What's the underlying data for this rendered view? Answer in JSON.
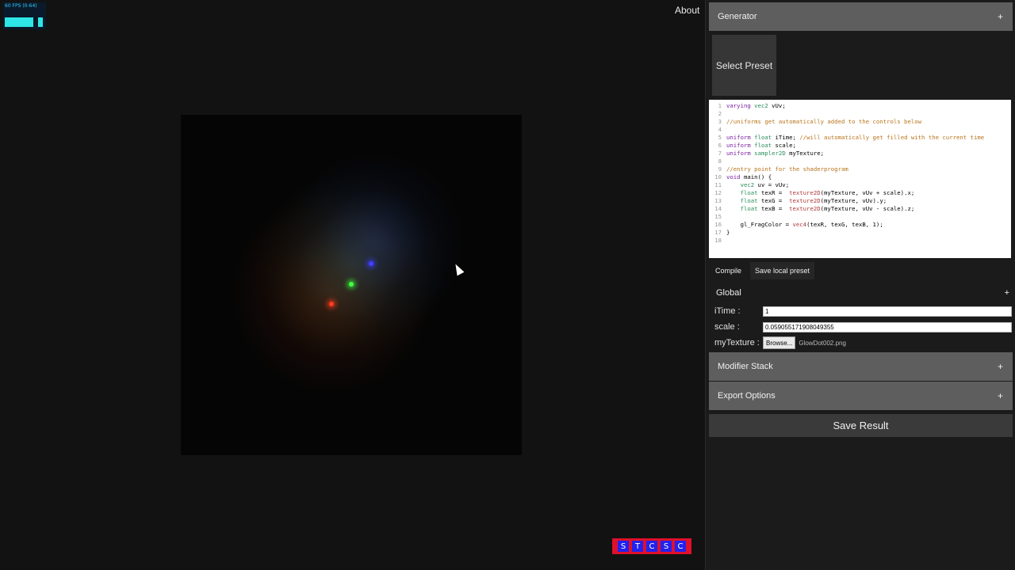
{
  "fps": {
    "label": "60 FPS (0-64)"
  },
  "header": {
    "about": "About"
  },
  "preview": {
    "description_dots": [
      "red",
      "green",
      "blue"
    ]
  },
  "stcsc": [
    "S",
    "T",
    "C",
    "S",
    "C"
  ],
  "panel": {
    "generator": {
      "title": "Generator",
      "toggle": "+"
    },
    "preset_button": "Select Preset",
    "code": [
      "varying vec2 vUv;",
      "",
      "//uniforms get automatically added to the controls below",
      "",
      "uniform float iTime; //will automatically get filled with the current time",
      "uniform float scale;",
      "uniform sampler2D myTexture;",
      "",
      "//entry point for the shaderprogram",
      "void main() {",
      "    vec2 uv = vUv;",
      "    float texR =  texture2D(myTexture, vUv + scale).x;",
      "    float texG =  texture2D(myTexture, vUv).y;",
      "    float texB =  texture2D(myTexture, vUv - scale).z;",
      "",
      "    gl_FragColor = vec4(texR, texG, texB, 1);",
      "}",
      ""
    ],
    "buttons": {
      "compile": "Compile",
      "save_local": "Save local preset"
    },
    "global": {
      "title": "Global",
      "toggle": "+"
    },
    "fields": {
      "itime_label": "iTime :",
      "itime_value": "1",
      "scale_label": "scale :",
      "scale_value": "0.059055171908049355",
      "texture_label": "myTexture :",
      "browse": "Browse...",
      "texture_file": "GlowDot002.png"
    },
    "modifier": {
      "title": "Modifier Stack",
      "toggle": "+"
    },
    "export": {
      "title": "Export Options",
      "toggle": "+"
    },
    "save_result": "Save Result"
  }
}
